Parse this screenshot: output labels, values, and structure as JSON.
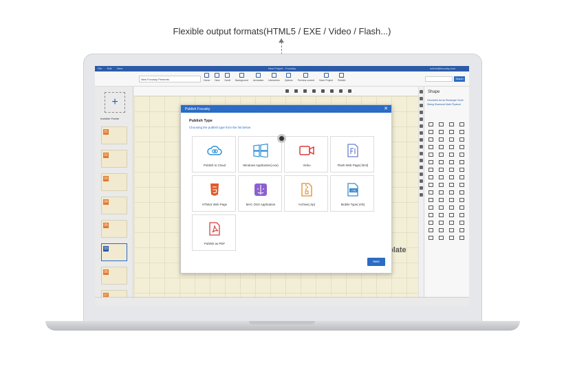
{
  "caption": "Flexible output formats(HTML5 / EXE / Video / Flash...)",
  "app": {
    "menu": [
      "File",
      "Edit",
      "View"
    ],
    "window_title": "New Project - Focusky",
    "user": "admin@focusky.com",
    "document_name": "New Focusky Presents"
  },
  "toolbar": {
    "items": [
      "Home",
      "New",
      "Scroll",
      "Background",
      "Animation",
      "Interaction",
      "Options",
      "Preview current",
      "Save Project",
      "Publish"
    ],
    "search_label": "Search"
  },
  "left_panel": {
    "new_label": "+",
    "frame_label": "Invisible Frame",
    "thumbs": [
      "01",
      "02",
      "03",
      "04",
      "05",
      "03",
      "06",
      "07"
    ]
  },
  "shape_panel": {
    "title": "Shape",
    "tabs": "Geometric  Arrow  Rectangle  Circle  Dialog  Sharemal  Math  Physical"
  },
  "canvas": {
    "bg_text": "plate"
  },
  "dialog": {
    "header": "Publish Focusky",
    "close": "✕",
    "title": "Publish Type",
    "subtitle": "Choosing the publish type from the list below",
    "options": [
      {
        "label": "Publish to Cloud",
        "icon": "cloud-icon",
        "color": "#2b8fd6"
      },
      {
        "label": "Windows Application(.exe)",
        "icon": "windows-icon",
        "color": "#2b8fd6"
      },
      {
        "label": "Video",
        "icon": "video-icon",
        "color": "#d83b3b"
      },
      {
        "label": "Flash Web Page(.html)",
        "icon": "flash-icon",
        "color": "#6a7fd0"
      },
      {
        "label": "HTML5 Web Page",
        "icon": "html5-icon",
        "color": "#e05a2b"
      },
      {
        "label": "MAC OSX Application",
        "icon": "mac-icon",
        "color": "#8d5fd0"
      },
      {
        "label": "Archive(.zip)",
        "icon": "zip-icon",
        "color": "#e08a2b"
      },
      {
        "label": "Mobile Type(.mfs)",
        "icon": "mobile-icon",
        "color": "#3a8ad0"
      },
      {
        "label": "Publish as PDF",
        "icon": "pdf-icon",
        "color": "#d83b3b"
      }
    ],
    "next_label": "Next"
  }
}
